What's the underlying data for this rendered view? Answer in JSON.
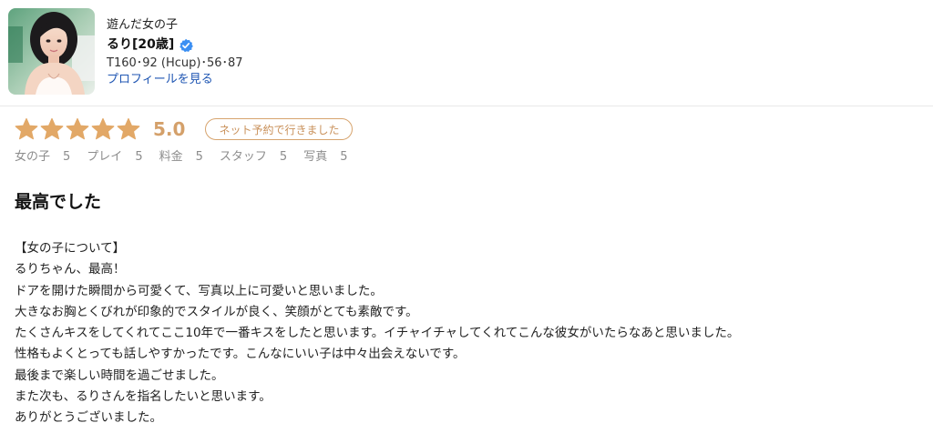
{
  "profile": {
    "played_label": "遊んだ女の子",
    "name": "るり[20歳]",
    "measurements": "T160･92 (Hcup)･56･87",
    "profile_link": "プロフィールを見る"
  },
  "rating": {
    "stars": 5,
    "max_stars": 5,
    "score": "5.0",
    "booking_badge": "ネット予約で行きました",
    "sub_ratings": [
      {
        "label": "女の子",
        "value": "5"
      },
      {
        "label": "プレイ",
        "value": "5"
      },
      {
        "label": "料金",
        "value": "5"
      },
      {
        "label": "スタッフ",
        "value": "5"
      },
      {
        "label": "写真",
        "value": "5"
      }
    ]
  },
  "review": {
    "title": "最高でした",
    "lines": [
      "【女の子について】",
      "るりちゃん、最高！",
      "ドアを開けた瞬間から可愛くて、写真以上に可愛いと思いました。",
      "大きなお胸とくびれが印象的でスタイルが良く、笑顔がとても素敵です。",
      "たくさんキスをしてくれてここ10年で一番キスをしたと思います。イチャイチャしてくれてこんな彼女がいたらなあと思いました。",
      "性格もよくとっても話しやすかったです。こんなにいい子は中々出会えないです。",
      "最後まで楽しい時間を過ごせました。",
      "また次も、るりさんを指名したいと思います。",
      "ありがとうございました。"
    ]
  },
  "colors": {
    "star": "#e2a867",
    "score": "#d4a06a",
    "badge_border": "#d7a46e",
    "link": "#1f56b3",
    "verified": "#3b8ff3",
    "muted": "#8c8c8c"
  },
  "icons": {
    "verified": "verified-check-icon",
    "star": "star-icon"
  }
}
